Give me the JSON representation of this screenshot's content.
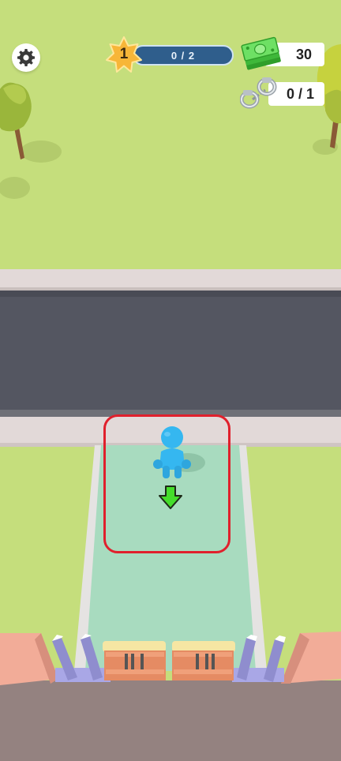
{
  "hud": {
    "settings_icon": "gear-icon",
    "level": "1",
    "level_progress_text": "0 / 2",
    "level_progress": 0,
    "money": "30",
    "money_icon": "cash-stack-icon",
    "prisoners": "0 / 1",
    "prisoners_icon": "handcuffs-icon"
  },
  "scene": {
    "objects": [
      "tree",
      "tree",
      "road",
      "sidewalk",
      "drop-zone",
      "player",
      "down-arrow",
      "gate",
      "gate-pillar"
    ],
    "colors": {
      "grass": "#c5de7c",
      "road": "#545661",
      "sidewalk": "#e2d9d8",
      "zone_border": "#e0202c",
      "zone_fill": "#a8dbbf",
      "player": "#35b7f0",
      "arrow": "#44dd2b",
      "wall": "#f2ac98",
      "ground": "#948280"
    }
  }
}
